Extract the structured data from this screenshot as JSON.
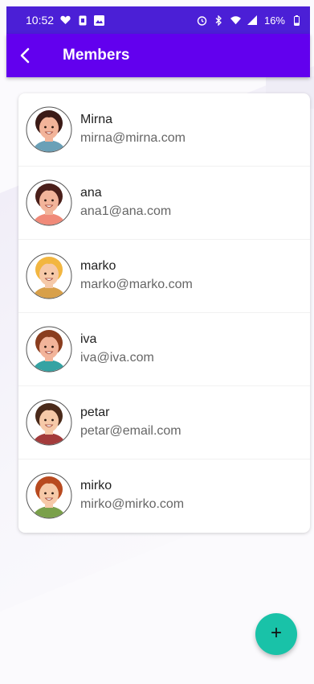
{
  "status_bar": {
    "time": "10:52",
    "battery": "16%",
    "left_icons": [
      "heart-icon",
      "sim-icon",
      "image-icon"
    ],
    "right_icons": [
      "alarm-icon",
      "bluetooth-icon",
      "wifi-icon",
      "signal-icon",
      "battery-icon"
    ]
  },
  "app_bar": {
    "title": "Members",
    "back_icon": "back-arrow-icon"
  },
  "members": [
    {
      "name": "Mirna",
      "email": "mirna@mirna.com",
      "hair": "#3b1a16",
      "skin": "#f2b49a",
      "shirt": "#6aa0b7"
    },
    {
      "name": "ana",
      "email": "ana1@ana.com",
      "hair": "#4a1f1a",
      "skin": "#f2b49a",
      "shirt": "#f08a79"
    },
    {
      "name": "marko",
      "email": "marko@marko.com",
      "hair": "#f2b640",
      "skin": "#f6c9a8",
      "shirt": "#d8a04a"
    },
    {
      "name": "iva",
      "email": "iva@iva.com",
      "hair": "#8a3d1e",
      "skin": "#f2b49a",
      "shirt": "#35a3a3"
    },
    {
      "name": "petar",
      "email": "petar@email.com",
      "hair": "#4a2a1a",
      "skin": "#f6c9a8",
      "shirt": "#a33b3b"
    },
    {
      "name": "mirko",
      "email": "mirko@mirko.com",
      "hair": "#b84a1f",
      "skin": "#f6c9a8",
      "shirt": "#7aa04a"
    }
  ],
  "fab": {
    "label": "+"
  },
  "colors": {
    "status_bar": "#4b1fd6",
    "app_bar": "#6200ee",
    "fab": "#19c2a8"
  }
}
